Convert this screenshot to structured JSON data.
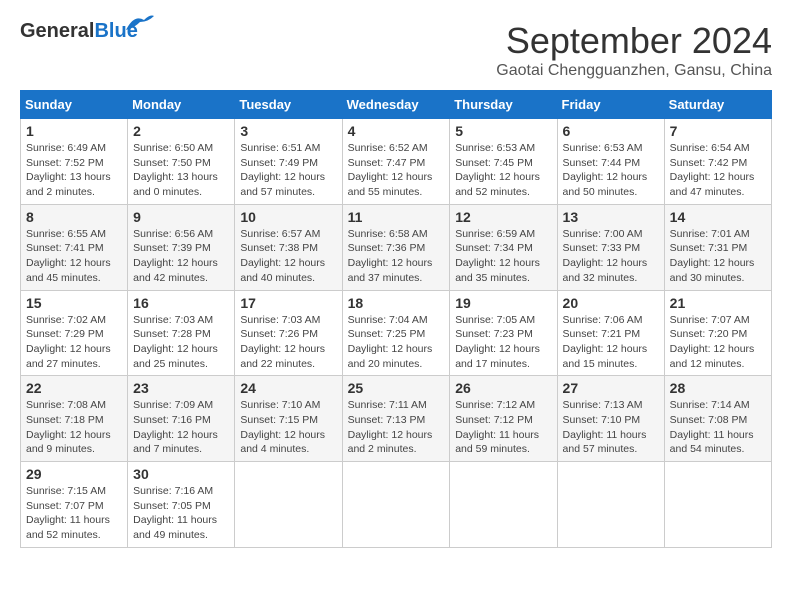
{
  "header": {
    "logo_general": "General",
    "logo_blue": "Blue",
    "month_title": "September 2024",
    "location": "Gaotai Chengguanzhen, Gansu, China"
  },
  "columns": [
    "Sunday",
    "Monday",
    "Tuesday",
    "Wednesday",
    "Thursday",
    "Friday",
    "Saturday"
  ],
  "weeks": [
    [
      {
        "day": "1",
        "info": "Sunrise: 6:49 AM\nSunset: 7:52 PM\nDaylight: 13 hours\nand 2 minutes."
      },
      {
        "day": "2",
        "info": "Sunrise: 6:50 AM\nSunset: 7:50 PM\nDaylight: 13 hours\nand 0 minutes."
      },
      {
        "day": "3",
        "info": "Sunrise: 6:51 AM\nSunset: 7:49 PM\nDaylight: 12 hours\nand 57 minutes."
      },
      {
        "day": "4",
        "info": "Sunrise: 6:52 AM\nSunset: 7:47 PM\nDaylight: 12 hours\nand 55 minutes."
      },
      {
        "day": "5",
        "info": "Sunrise: 6:53 AM\nSunset: 7:45 PM\nDaylight: 12 hours\nand 52 minutes."
      },
      {
        "day": "6",
        "info": "Sunrise: 6:53 AM\nSunset: 7:44 PM\nDaylight: 12 hours\nand 50 minutes."
      },
      {
        "day": "7",
        "info": "Sunrise: 6:54 AM\nSunset: 7:42 PM\nDaylight: 12 hours\nand 47 minutes."
      }
    ],
    [
      {
        "day": "8",
        "info": "Sunrise: 6:55 AM\nSunset: 7:41 PM\nDaylight: 12 hours\nand 45 minutes."
      },
      {
        "day": "9",
        "info": "Sunrise: 6:56 AM\nSunset: 7:39 PM\nDaylight: 12 hours\nand 42 minutes."
      },
      {
        "day": "10",
        "info": "Sunrise: 6:57 AM\nSunset: 7:38 PM\nDaylight: 12 hours\nand 40 minutes."
      },
      {
        "day": "11",
        "info": "Sunrise: 6:58 AM\nSunset: 7:36 PM\nDaylight: 12 hours\nand 37 minutes."
      },
      {
        "day": "12",
        "info": "Sunrise: 6:59 AM\nSunset: 7:34 PM\nDaylight: 12 hours\nand 35 minutes."
      },
      {
        "day": "13",
        "info": "Sunrise: 7:00 AM\nSunset: 7:33 PM\nDaylight: 12 hours\nand 32 minutes."
      },
      {
        "day": "14",
        "info": "Sunrise: 7:01 AM\nSunset: 7:31 PM\nDaylight: 12 hours\nand 30 minutes."
      }
    ],
    [
      {
        "day": "15",
        "info": "Sunrise: 7:02 AM\nSunset: 7:29 PM\nDaylight: 12 hours\nand 27 minutes."
      },
      {
        "day": "16",
        "info": "Sunrise: 7:03 AM\nSunset: 7:28 PM\nDaylight: 12 hours\nand 25 minutes."
      },
      {
        "day": "17",
        "info": "Sunrise: 7:03 AM\nSunset: 7:26 PM\nDaylight: 12 hours\nand 22 minutes."
      },
      {
        "day": "18",
        "info": "Sunrise: 7:04 AM\nSunset: 7:25 PM\nDaylight: 12 hours\nand 20 minutes."
      },
      {
        "day": "19",
        "info": "Sunrise: 7:05 AM\nSunset: 7:23 PM\nDaylight: 12 hours\nand 17 minutes."
      },
      {
        "day": "20",
        "info": "Sunrise: 7:06 AM\nSunset: 7:21 PM\nDaylight: 12 hours\nand 15 minutes."
      },
      {
        "day": "21",
        "info": "Sunrise: 7:07 AM\nSunset: 7:20 PM\nDaylight: 12 hours\nand 12 minutes."
      }
    ],
    [
      {
        "day": "22",
        "info": "Sunrise: 7:08 AM\nSunset: 7:18 PM\nDaylight: 12 hours\nand 9 minutes."
      },
      {
        "day": "23",
        "info": "Sunrise: 7:09 AM\nSunset: 7:16 PM\nDaylight: 12 hours\nand 7 minutes."
      },
      {
        "day": "24",
        "info": "Sunrise: 7:10 AM\nSunset: 7:15 PM\nDaylight: 12 hours\nand 4 minutes."
      },
      {
        "day": "25",
        "info": "Sunrise: 7:11 AM\nSunset: 7:13 PM\nDaylight: 12 hours\nand 2 minutes."
      },
      {
        "day": "26",
        "info": "Sunrise: 7:12 AM\nSunset: 7:12 PM\nDaylight: 11 hours\nand 59 minutes."
      },
      {
        "day": "27",
        "info": "Sunrise: 7:13 AM\nSunset: 7:10 PM\nDaylight: 11 hours\nand 57 minutes."
      },
      {
        "day": "28",
        "info": "Sunrise: 7:14 AM\nSunset: 7:08 PM\nDaylight: 11 hours\nand 54 minutes."
      }
    ],
    [
      {
        "day": "29",
        "info": "Sunrise: 7:15 AM\nSunset: 7:07 PM\nDaylight: 11 hours\nand 52 minutes."
      },
      {
        "day": "30",
        "info": "Sunrise: 7:16 AM\nSunset: 7:05 PM\nDaylight: 11 hours\nand 49 minutes."
      },
      {
        "day": "",
        "info": ""
      },
      {
        "day": "",
        "info": ""
      },
      {
        "day": "",
        "info": ""
      },
      {
        "day": "",
        "info": ""
      },
      {
        "day": "",
        "info": ""
      }
    ]
  ]
}
